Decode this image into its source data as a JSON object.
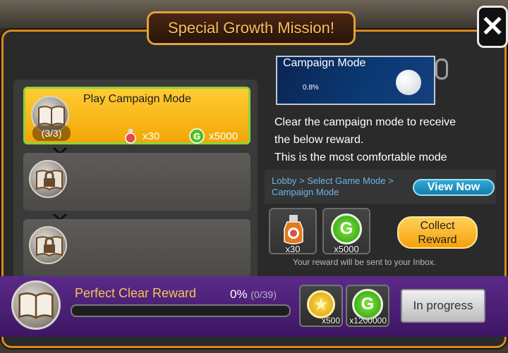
{
  "header": {
    "title": "Special Growth Mission!"
  },
  "missions": [
    {
      "title": "Play Campaign Mode",
      "progress": "(3/3)",
      "reward_a": "x30",
      "reward_b": "x5000",
      "state": "active"
    },
    {
      "state": "locked"
    },
    {
      "state": "locked"
    }
  ],
  "detail": {
    "banner_title": "Campaign Mode",
    "banner_pct": "0.8%",
    "desc_line1": "Clear the campaign mode to receive",
    "desc_line2": "the below reward.",
    "desc_line3": "This is the most comfortable mode",
    "path_line1": "Lobby > Select Game Mode >",
    "path_line2": "Campaign Mode",
    "view_now_label": "View Now",
    "reward1_qty": "x30",
    "reward2_qty": "x5000",
    "collect_line1": "Collect",
    "collect_line2": "Reward",
    "inbox_note": "Your reward will be sent to your Inbox."
  },
  "perfect": {
    "title": "Perfect Clear Reward",
    "percent": "0%",
    "count": "(0/39)",
    "progress_fraction": 0,
    "reward1_qty": "x500",
    "reward2_qty": "x1200000",
    "status_label": "In progress"
  },
  "colors": {
    "accent_gold": "#f7c25a",
    "active_mission": "#f2a707",
    "bottom_bar": "#4b1f76",
    "link_blue": "#69b6e9"
  }
}
